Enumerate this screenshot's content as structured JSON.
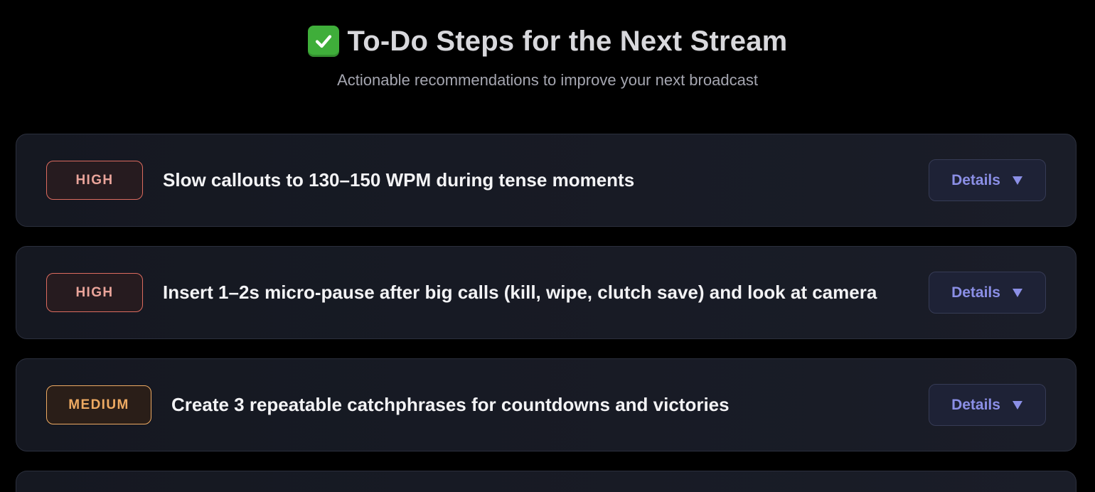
{
  "header": {
    "title": "To-Do Steps for the Next Stream",
    "title_icon": "check-mark-button-icon",
    "subtitle": "Actionable recommendations to improve your next broadcast"
  },
  "colors": {
    "background": "#000000",
    "high": "#dc6b5f",
    "medium": "#eeaa62",
    "details_accent": "#8b8fe6"
  },
  "items": [
    {
      "priority": "HIGH",
      "text": "Slow callouts to 130–150 WPM during tense moments",
      "details_label": "Details",
      "details_icon": "caret-down-icon"
    },
    {
      "priority": "HIGH",
      "text": "Insert 1–2s micro-pause after big calls (kill, wipe, clutch save) and look at camera",
      "details_label": "Details",
      "details_icon": "caret-down-icon"
    },
    {
      "priority": "MEDIUM",
      "text": "Create 3 repeatable catchphrases for countdowns and victories",
      "details_label": "Details",
      "details_icon": "caret-down-icon"
    }
  ]
}
